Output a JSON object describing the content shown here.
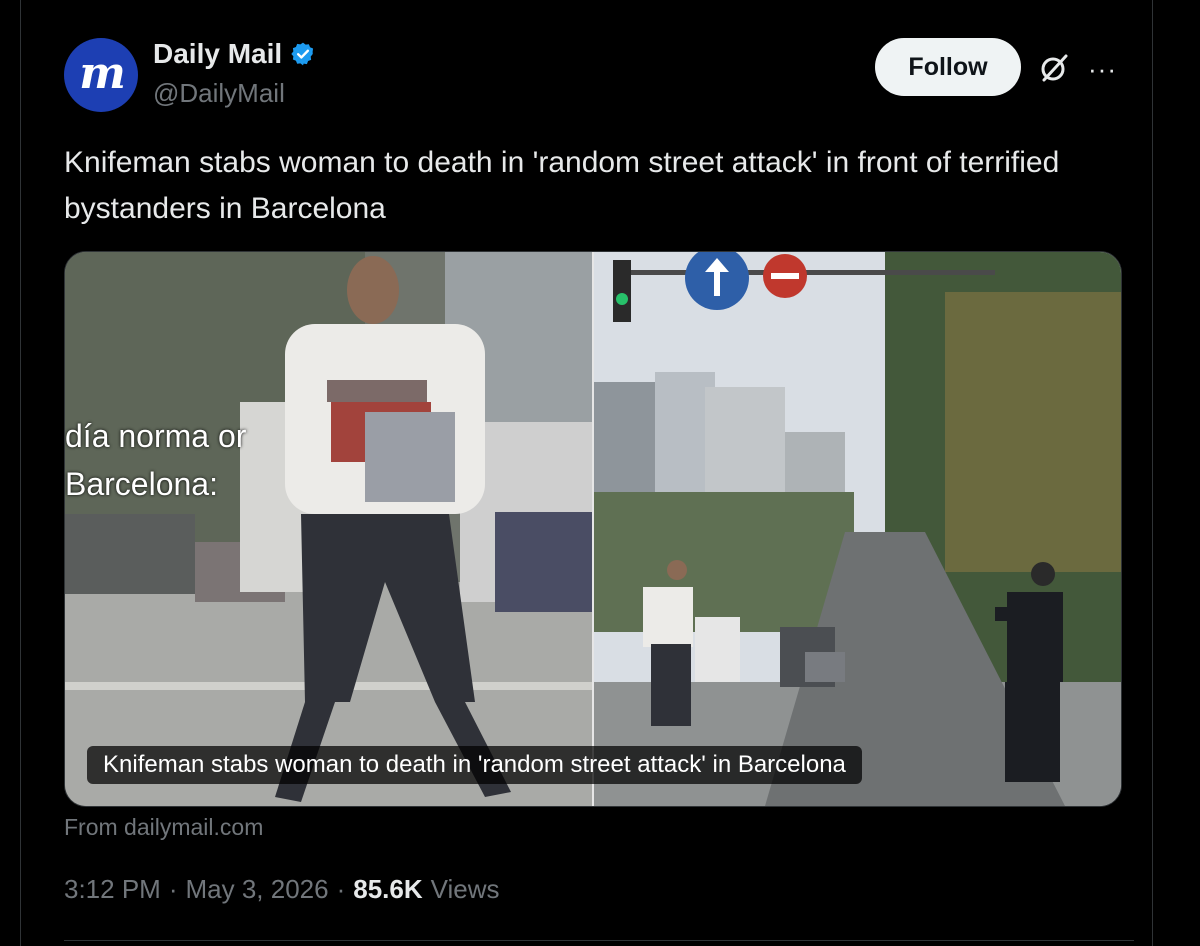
{
  "account": {
    "name": "Daily Mail",
    "handle": "@DailyMail",
    "avatar_letter": "m",
    "verified": true,
    "brand_color": "#1d3fb3",
    "verified_color": "#1d9bf0"
  },
  "actions": {
    "follow_label": "Follow",
    "grok_icon": "grok-icon",
    "more_label": "···"
  },
  "post": {
    "text": "Knifeman stabs woman to death in 'random street attack' in front of terrified bystanders in Barcelona"
  },
  "media": {
    "caption": "Knifeman stabs woman to death in 'random street attack' in Barcelona",
    "overlay_line1": "día norma   or",
    "overlay_line2": "Barcelona:",
    "source": "From dailymail.com"
  },
  "meta": {
    "time": "3:12 PM",
    "separator": "·",
    "date": "May 3, 2026",
    "views_count": "85.6K",
    "views_label": "Views"
  }
}
